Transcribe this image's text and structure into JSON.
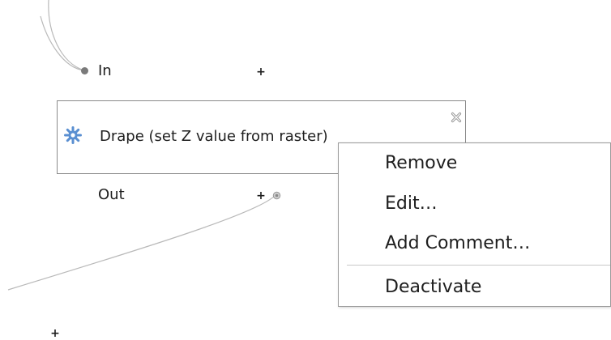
{
  "model": {
    "input_label": "In",
    "add_symbol": "+",
    "algorithm": {
      "title": "Drape (set Z value from raster)",
      "icon": "gear-icon",
      "close_icon": "close-icon"
    },
    "output_label": "Out"
  },
  "context_menu": {
    "items": [
      {
        "label": "Remove"
      },
      {
        "label": "Edit…"
      },
      {
        "label": "Add Comment…"
      },
      {
        "label": "Deactivate"
      }
    ]
  },
  "colors": {
    "wire": "#b0b0b0",
    "port": "#7a7a7a",
    "icon_blue": "#5a8fd1"
  }
}
